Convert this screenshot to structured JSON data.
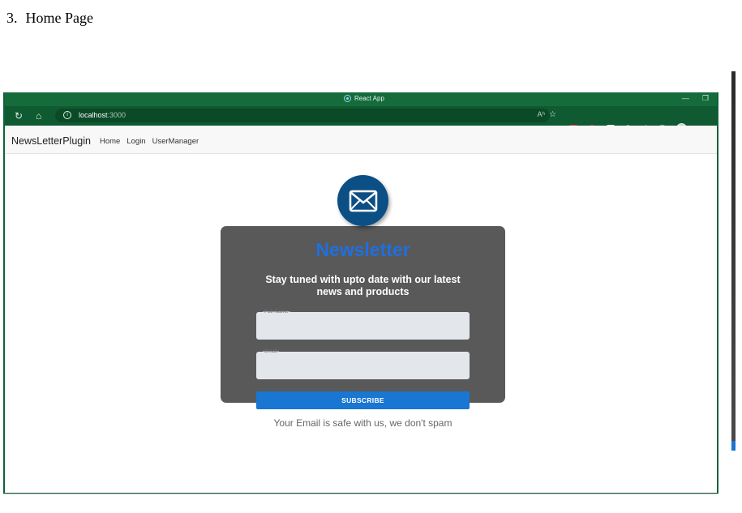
{
  "document": {
    "section_number": "3.",
    "section_title": "Home Page"
  },
  "browser": {
    "tab_title": "React App",
    "url_host": "localhost",
    "url_port": ":3000",
    "read_aloud": "Aʰ",
    "theme_color": "#166b3b"
  },
  "navbar": {
    "brand": "NewsLetterPlugin",
    "links": [
      "Home",
      "Login",
      "UserManager"
    ]
  },
  "newsletter": {
    "title": "Newsletter",
    "subtitle": "Stay tuned with upto date with our latest news and products",
    "fields": [
      {
        "label": "Full Name",
        "value": ""
      },
      {
        "label": "Email",
        "value": ""
      }
    ],
    "button_label": "SUBSCRIBE",
    "footer_note": "Your Email is safe with us, we don't spam",
    "title_color": "#1f6fe0",
    "card_color": "#595959",
    "button_color": "#1976d2",
    "badge_color": "#0c4f84",
    "badge_icon": "envelope-icon"
  }
}
